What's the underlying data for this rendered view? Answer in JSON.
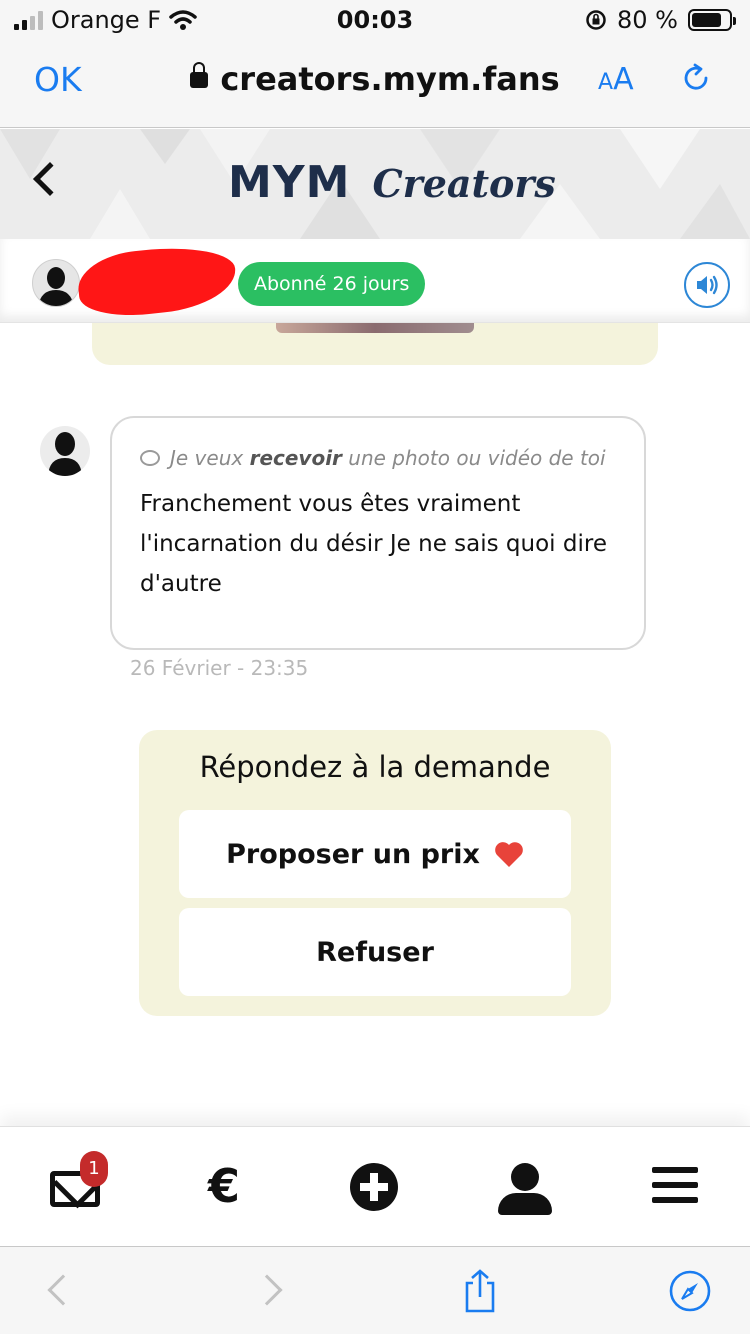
{
  "status_bar": {
    "carrier": "Orange F",
    "time": "00:03",
    "battery": "80 %"
  },
  "browser": {
    "ok_label": "OK",
    "url": "creators.mym.fans",
    "text_size_small": "A",
    "text_size_large": "A"
  },
  "header": {
    "logo_brand": "MYM",
    "logo_product": "Creators"
  },
  "subscriber": {
    "badge": "Abonné 26 jours"
  },
  "message": {
    "request_prefix": "Je veux ",
    "request_bold": "recevoir",
    "request_suffix": " une photo ou vidéo de toi",
    "text": "Franchement vous êtes vraiment l'incarnation du désir Je ne sais quoi dire d'autre",
    "timestamp": "26 Février - 23:35"
  },
  "reply": {
    "title": "Répondez à la demande",
    "propose_label": "Proposer un prix",
    "refuse_label": "Refuser"
  },
  "bottom_nav": {
    "notification_count": "1",
    "items": [
      "mail-icon",
      "euro-icon",
      "plus-circle-icon",
      "user-icon",
      "menu-icon"
    ]
  },
  "colors": {
    "accent_blue": "#1a7cf0",
    "badge_green": "#2bbf62",
    "card_cream": "#f4f3dc",
    "brand_navy": "#1e2e4a",
    "brand_red": "#d3232c",
    "heart_red": "#e8433a"
  }
}
